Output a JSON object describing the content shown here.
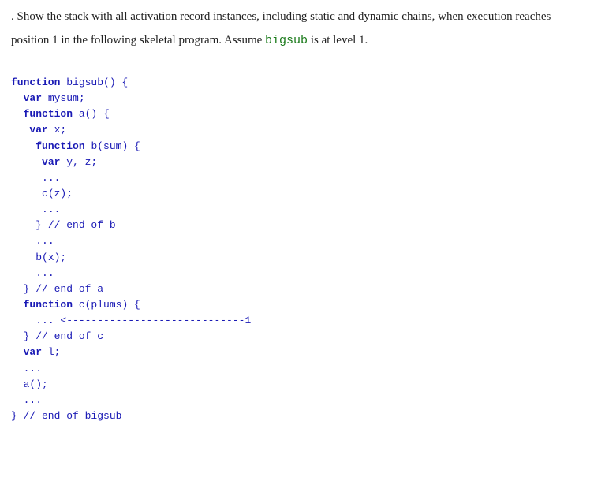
{
  "prompt": {
    "lead_dot": ". ",
    "text_before": "Show the stack with all activation record instances, including static and dynamic chains, when execution reaches position 1 in the following skeletal program. Assume ",
    "inline_code": "bigsub",
    "text_after": " is at level 1."
  },
  "code": {
    "l01_kw": "function",
    "l01_rest": " bigsub() {",
    "l02_kw": "var",
    "l02_rest": " mysum;",
    "l03_kw": "function",
    "l03_rest": " a() {",
    "l04_kw": "var",
    "l04_rest": " x;",
    "l05_kw": "function",
    "l05_rest": " b(sum) {",
    "l06_kw": "var",
    "l06_rest": " y, z;",
    "l07": "...",
    "l08": "c(z);",
    "l09": "...",
    "l10": "} // end of b",
    "l11": "...",
    "l12": "b(x);",
    "l13": "...",
    "l14": "} // end of a",
    "l15_kw": "function",
    "l15_rest": " c(plums) {",
    "l16": "... <-----------------------------1",
    "l17": "} // end of c",
    "l18_kw": "var",
    "l18_rest": " l;",
    "l19": "...",
    "l20": "a();",
    "l21": "...",
    "l22": "} // end of bigsub"
  }
}
